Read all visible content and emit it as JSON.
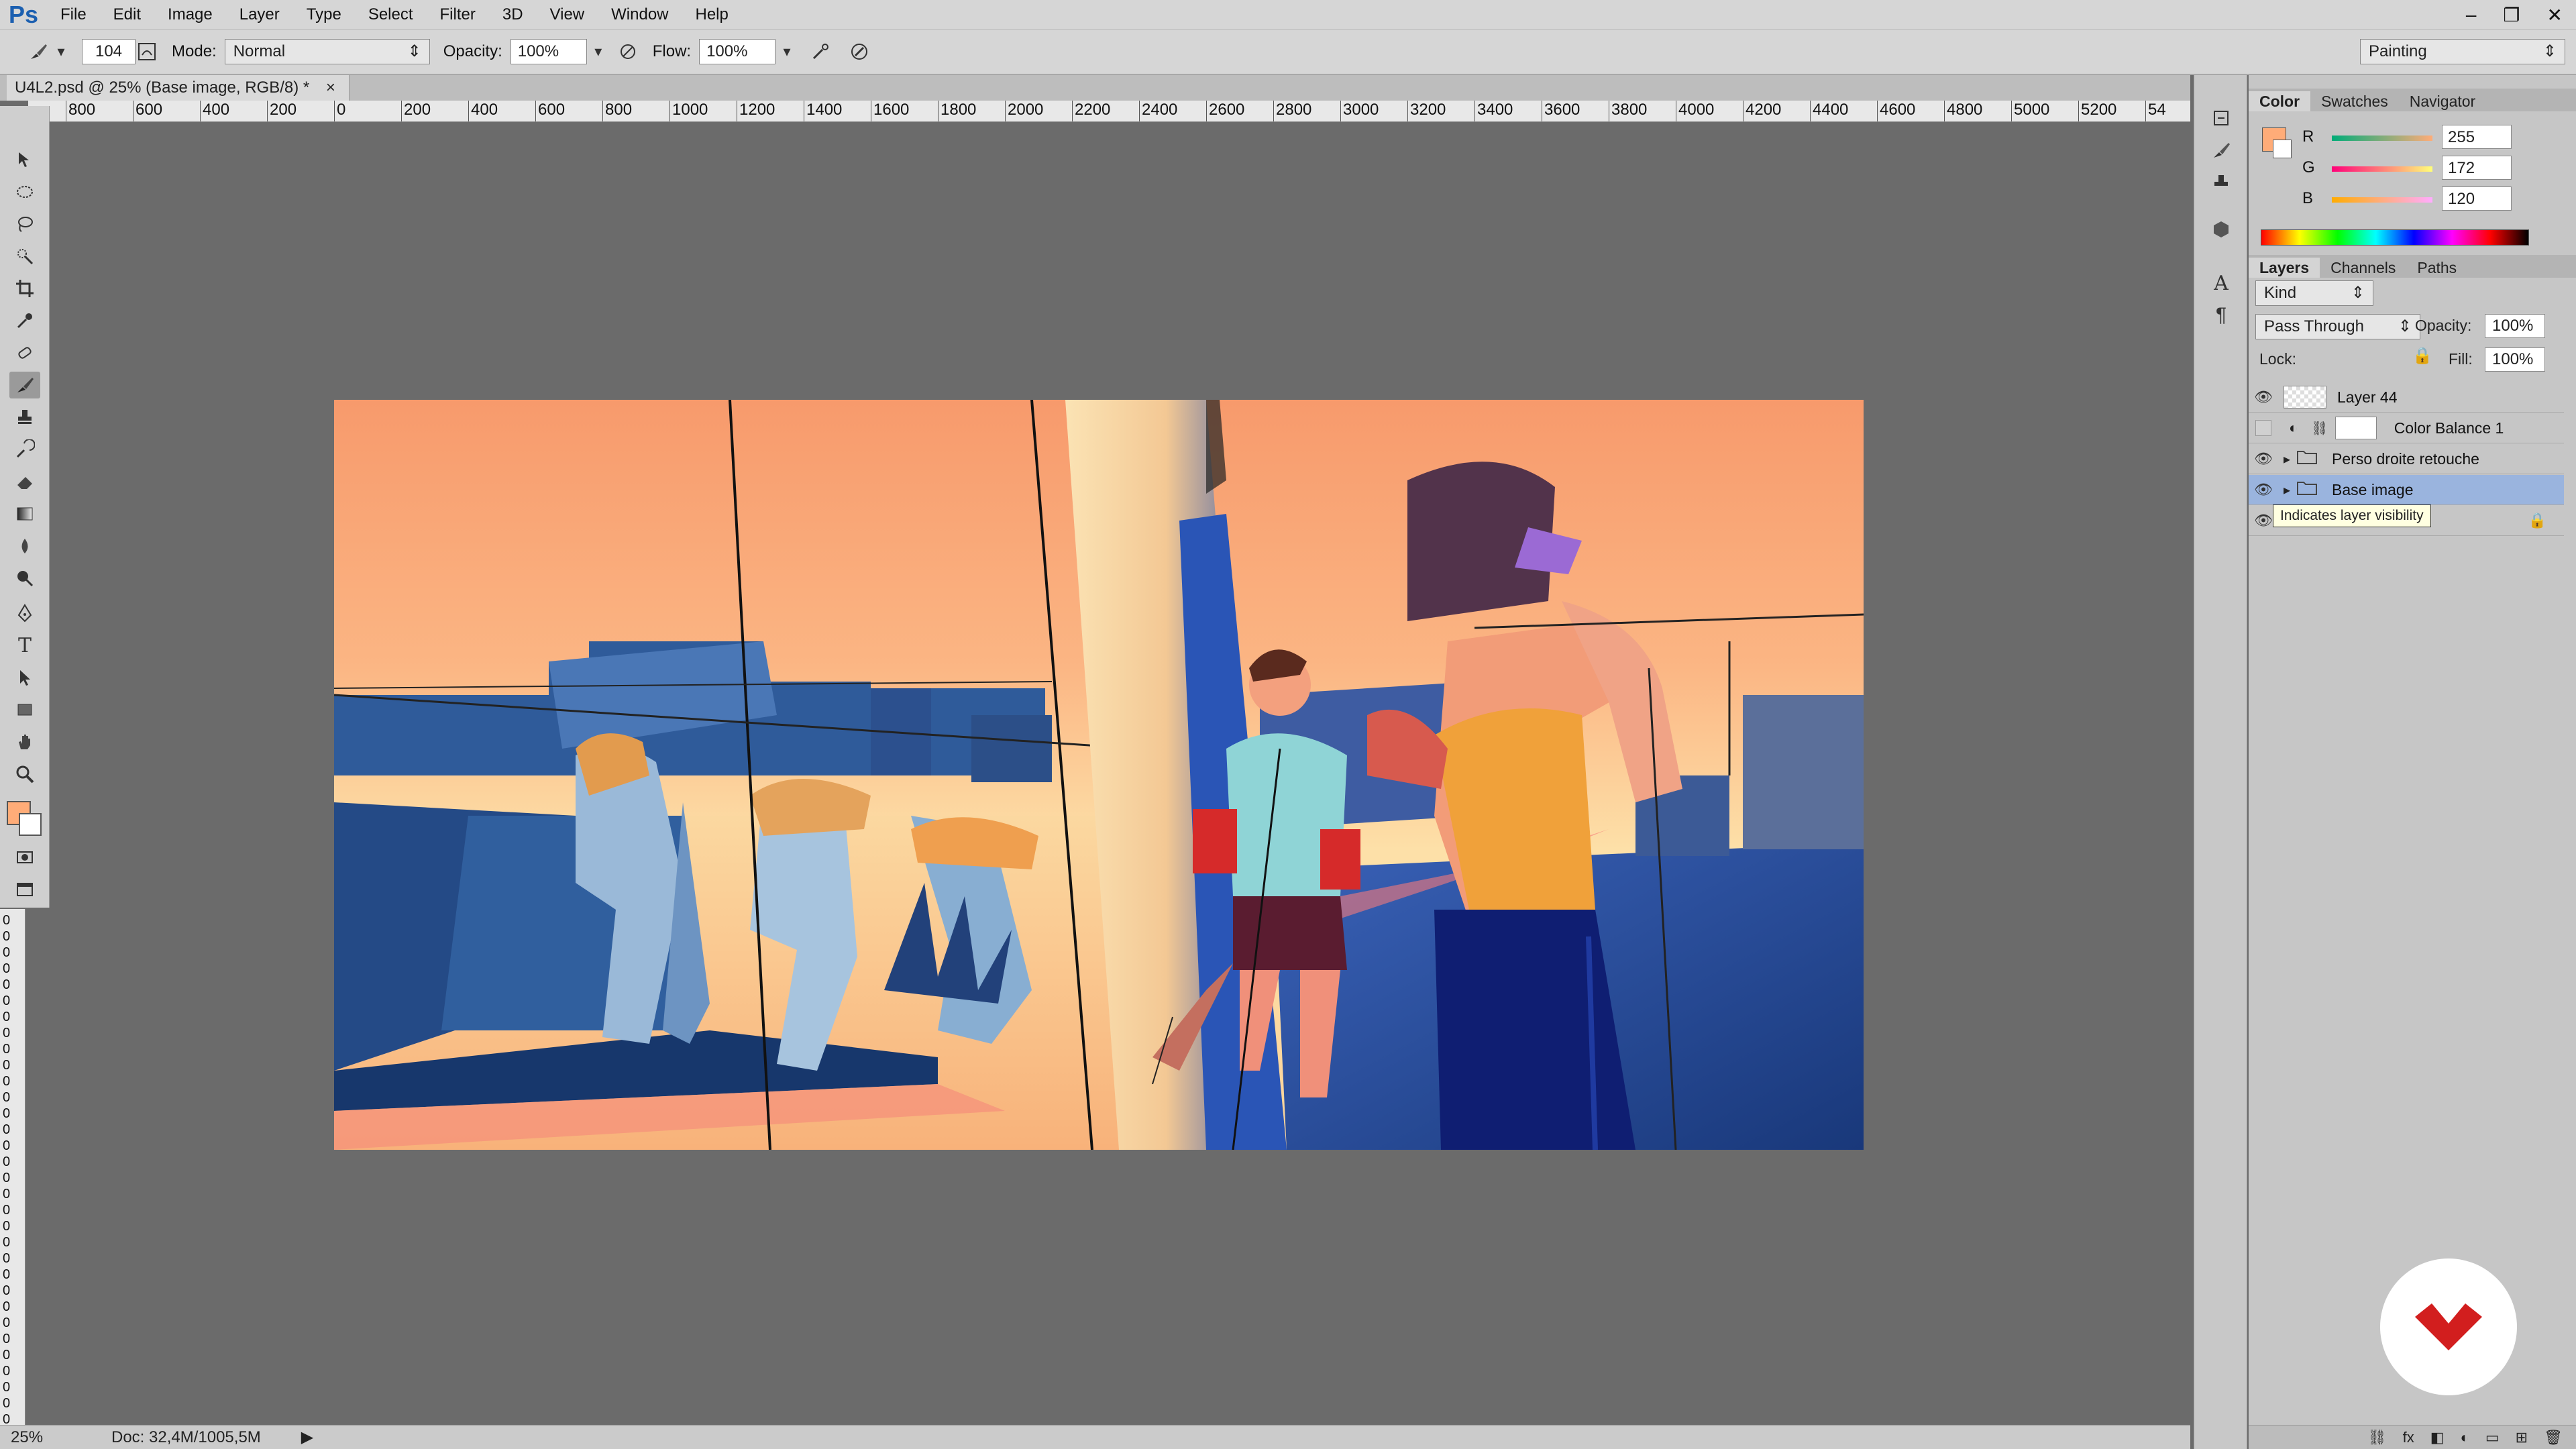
{
  "app": {
    "logo": "Ps"
  },
  "menu": [
    "File",
    "Edit",
    "Image",
    "Layer",
    "Type",
    "Select",
    "Filter",
    "3D",
    "View",
    "Window",
    "Help"
  ],
  "window_controls": {
    "minimize": "–",
    "restore": "❐",
    "close": "✕"
  },
  "options": {
    "brush_size": "104",
    "mode_label": "Mode:",
    "mode_value": "Normal",
    "opacity_label": "Opacity:",
    "opacity_value": "100%",
    "flow_label": "Flow:",
    "flow_value": "100%",
    "workspace": "Painting"
  },
  "document": {
    "tab_title": "U4L2.psd @ 25% (Base image, RGB/8) *",
    "close": "×"
  },
  "ruler_h": [
    "800",
    "600",
    "400",
    "200",
    "0",
    "200",
    "400",
    "600",
    "800",
    "1000",
    "1200",
    "1400",
    "1600",
    "1800",
    "2000",
    "2200",
    "2400",
    "2600",
    "2800",
    "3000",
    "3200",
    "3400",
    "3600",
    "3800",
    "4000",
    "4200",
    "4400",
    "4600",
    "4800",
    "5000",
    "5200",
    "54"
  ],
  "ruler_v": [
    "0",
    "0",
    "0",
    "0",
    "0",
    "0",
    "0",
    "0",
    "0",
    "0",
    "0",
    "0",
    "0",
    "0",
    "0",
    "0",
    "0",
    "0",
    "0",
    "0",
    "0",
    "0",
    "0",
    "0",
    "0",
    "0",
    "0",
    "0",
    "0",
    "0",
    "0",
    "0"
  ],
  "color_panel": {
    "tabs": [
      "Color",
      "Swatches",
      "Navigator"
    ],
    "active_tab": "Color",
    "r_label": "R",
    "r_value": "255",
    "g_label": "G",
    "g_value": "172",
    "b_label": "B",
    "b_value": "120",
    "foreground": "#ffac78",
    "background": "#ffffff"
  },
  "layers_panel": {
    "tabs": [
      "Layers",
      "Channels",
      "Paths"
    ],
    "active_tab": "Layers",
    "filter_kind": "Kind",
    "blend_mode": "Pass Through",
    "opacity_label": "Opacity:",
    "opacity_value": "100%",
    "lock_label": "Lock:",
    "fill_label": "Fill:",
    "fill_value": "100%",
    "layers": [
      {
        "name": "Layer 44",
        "visible": true
      },
      {
        "name": "Color Balance 1",
        "visible": false
      },
      {
        "name": "Perso droite retouche",
        "visible": true
      },
      {
        "name": "Base image",
        "visible": true,
        "selected": true
      }
    ],
    "tooltip": "Indicates layer visibility"
  },
  "status": {
    "zoom": "25%",
    "doc": "Doc: 32,4M/1005,5M"
  },
  "icons": [
    "brush-icon",
    "move-icon",
    "marquee-icon",
    "lasso-icon",
    "quick-select-icon",
    "crop-icon",
    "eyedropper-icon",
    "healing-icon",
    "brush-tool-icon",
    "stamp-icon",
    "history-brush-icon",
    "eraser-icon",
    "gradient-icon",
    "blur-icon",
    "dodge-icon",
    "pen-icon",
    "type-icon",
    "path-select-icon",
    "shape-icon",
    "hand-icon",
    "zoom-icon",
    "eye-icon",
    "folder-icon",
    "lock-icon",
    "logo-badge-icon"
  ]
}
